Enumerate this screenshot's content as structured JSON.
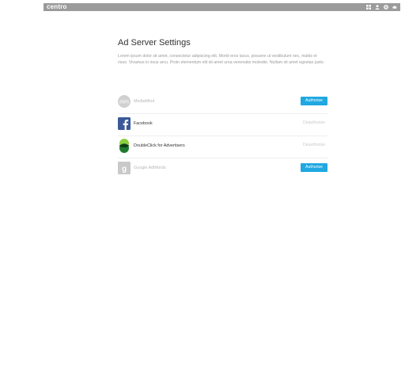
{
  "topbar": {
    "brand": "centro",
    "icons": [
      "grid-icon",
      "user-icon",
      "gear-icon",
      "cloud-icon"
    ]
  },
  "page": {
    "title": "Ad Server Settings",
    "description": "Lorem ipsum dolor sit amet, consectetur adipiscing elit. Morbi eros lacus, posuere ut vestibulum nec, mattis et risus. Vivamus in risus arcu. Proin elementum elit sit amet urna venenatis molestie. Nullam sit amet egestas justo."
  },
  "services": [
    {
      "name": "MediaMind",
      "action": "Authorize",
      "status": "unauthorized",
      "icon": "mediamind-logo"
    },
    {
      "name": "Facebook",
      "action": "Deauthorize",
      "status": "authorized",
      "icon": "facebook-logo"
    },
    {
      "name": "DoubleClick for Advertisers",
      "action": "Deauthorize",
      "status": "authorized",
      "icon": "doubleclick-logo"
    },
    {
      "name": "Google AdWords",
      "action": "Authorize",
      "status": "unauthorized",
      "icon": "google-adwords-logo"
    }
  ],
  "colors": {
    "topbar": "#9b9b9b",
    "authorize_button": "#1fa8e1",
    "facebook": "#3b5998",
    "doubleclick": "#2f9e3f"
  }
}
